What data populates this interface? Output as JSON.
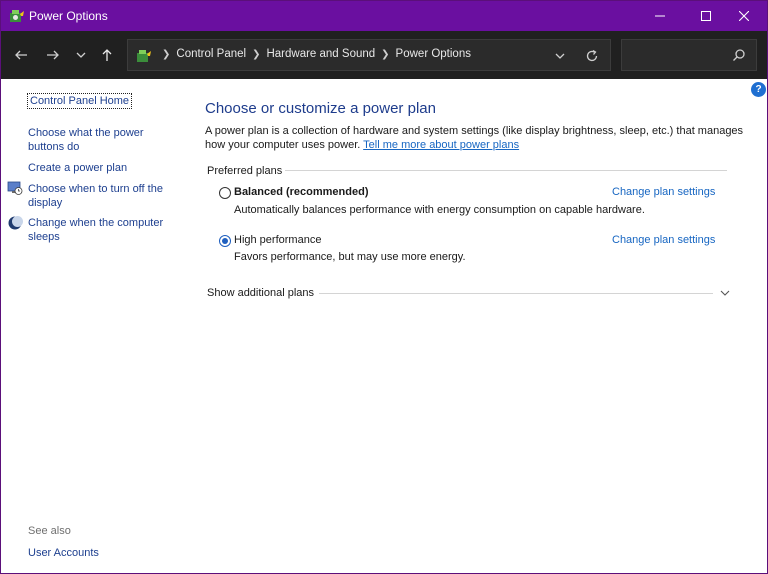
{
  "window": {
    "title": "Power Options",
    "accent": "#6a0fa0"
  },
  "address": {
    "crumbs": [
      "Control Panel",
      "Hardware and Sound",
      "Power Options"
    ],
    "search_placeholder": ""
  },
  "sidebar": {
    "home": "Control Panel Home",
    "items": [
      {
        "label_line1": "Choose what the power",
        "label_line2": "buttons do",
        "icon": ""
      },
      {
        "label_line1": "Create a power plan",
        "label_line2": "",
        "icon": ""
      },
      {
        "label_line1": "Choose when to turn off the",
        "label_line2": "display",
        "icon": "monitor-clock-icon"
      },
      {
        "label_line1": "Change when the computer",
        "label_line2": "sleeps",
        "icon": "moon-icon"
      }
    ],
    "see_also_label": "See also",
    "see_also_links": [
      "User Accounts"
    ]
  },
  "main": {
    "heading": "Choose or customize a power plan",
    "desc_line1": "A power plan is a collection of hardware and system settings (like display brightness, sleep, etc.) that manages",
    "desc_line2_prefix": "how your computer uses power.",
    "desc_link": "Tell me more about power plans",
    "group_title": "Preferred plans",
    "plans": [
      {
        "name": "Balanced (recommended)",
        "description": "Automatically balances performance with energy consumption on capable hardware.",
        "link": "Change plan settings",
        "selected": false
      },
      {
        "name": "High performance",
        "description": "Favors performance, but may use more energy.",
        "link": "Change plan settings",
        "selected": true
      }
    ],
    "show_more": "Show additional plans"
  }
}
